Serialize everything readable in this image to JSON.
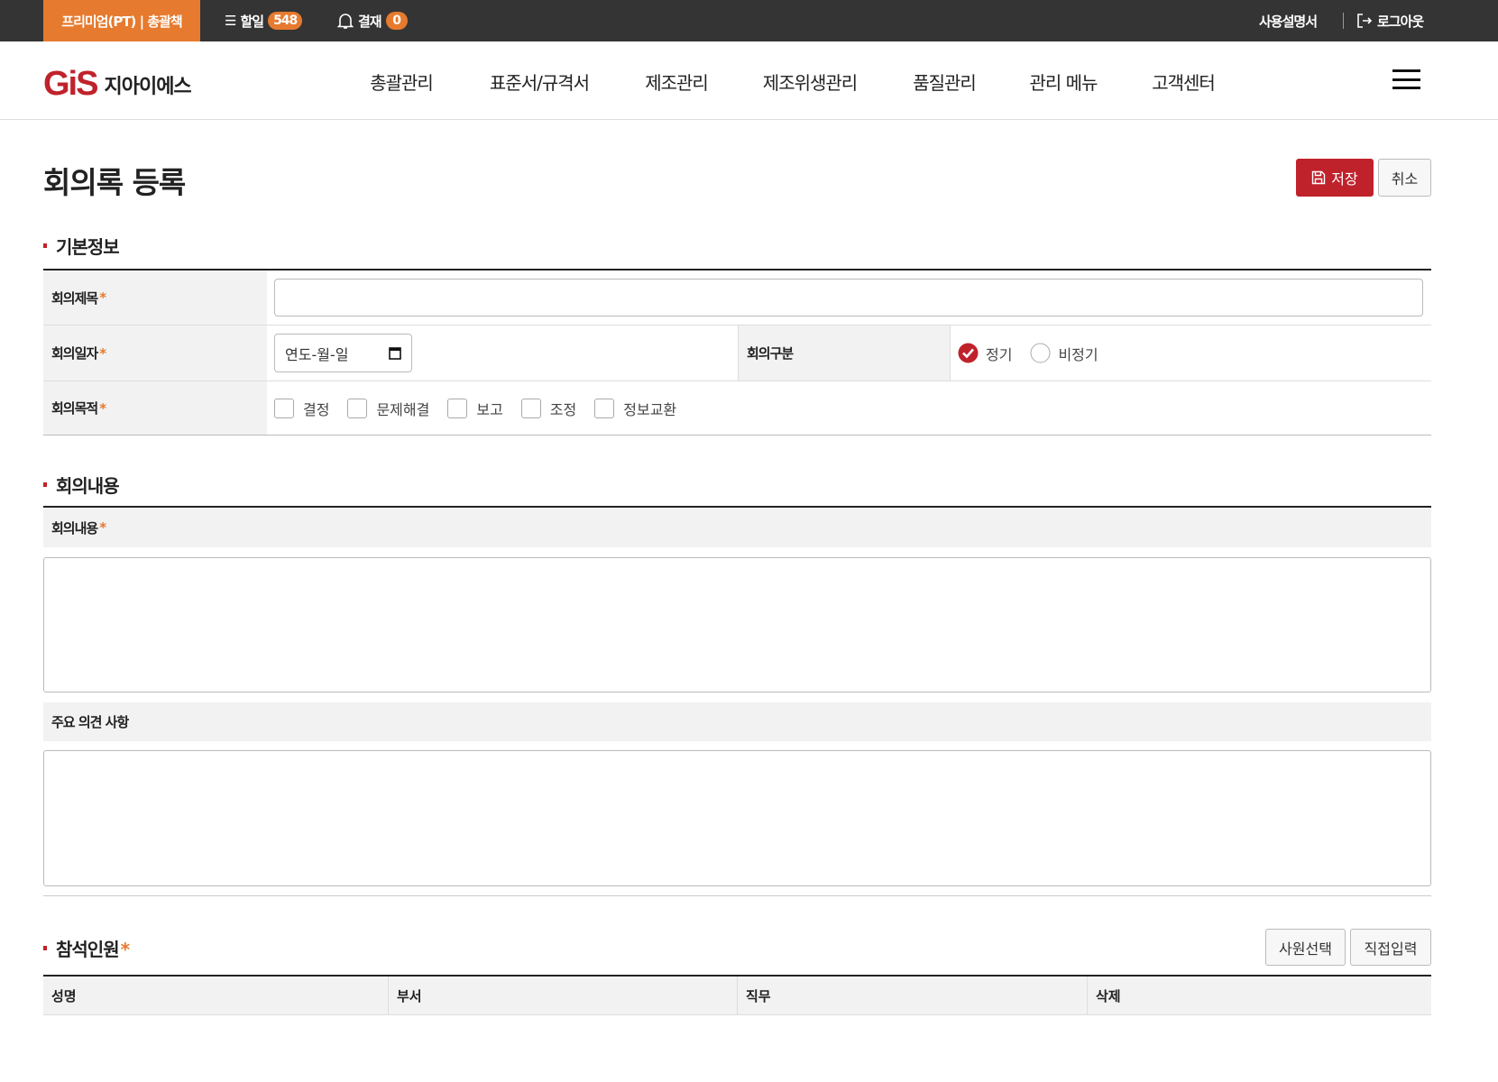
{
  "topbar": {
    "plan": "프리미엄(PT) | 총괄책",
    "todo_label": "할일",
    "todo_count": "548",
    "approval_label": "결재",
    "approval_count": "0",
    "manual": "사용설명서",
    "logout": "로그아웃"
  },
  "header": {
    "logo_mark": "GiS",
    "logo_text": "지아이에스",
    "nav": [
      "총괄관리",
      "표준서/규격서",
      "제조관리",
      "제조위생관리",
      "품질관리",
      "관리 메뉴",
      "고객센터"
    ]
  },
  "page": {
    "title": "회의록 등록",
    "save": "저장",
    "cancel": "취소"
  },
  "basic": {
    "heading": "기본정보",
    "title_label": "회의제목",
    "title_value": "",
    "date_label": "회의일자",
    "date_placeholder": "연도-월-일",
    "type_label": "회의구분",
    "type_options": [
      "정기",
      "비정기"
    ],
    "type_selected": "정기",
    "purpose_label": "회의목적",
    "purpose_options": [
      "결정",
      "문제해결",
      "보고",
      "조정",
      "정보교환"
    ],
    "required": "*"
  },
  "content": {
    "heading": "회의내용",
    "content_label": "회의내용",
    "opinion_label": "주요 의견 사항"
  },
  "attendees": {
    "heading": "참석인원",
    "select_btn": "사원선택",
    "direct_btn": "직접입력",
    "columns": [
      "성명",
      "부서",
      "직무",
      "삭제"
    ]
  },
  "colors": {
    "accent": "#c0222b",
    "orange": "#e67a2e"
  }
}
